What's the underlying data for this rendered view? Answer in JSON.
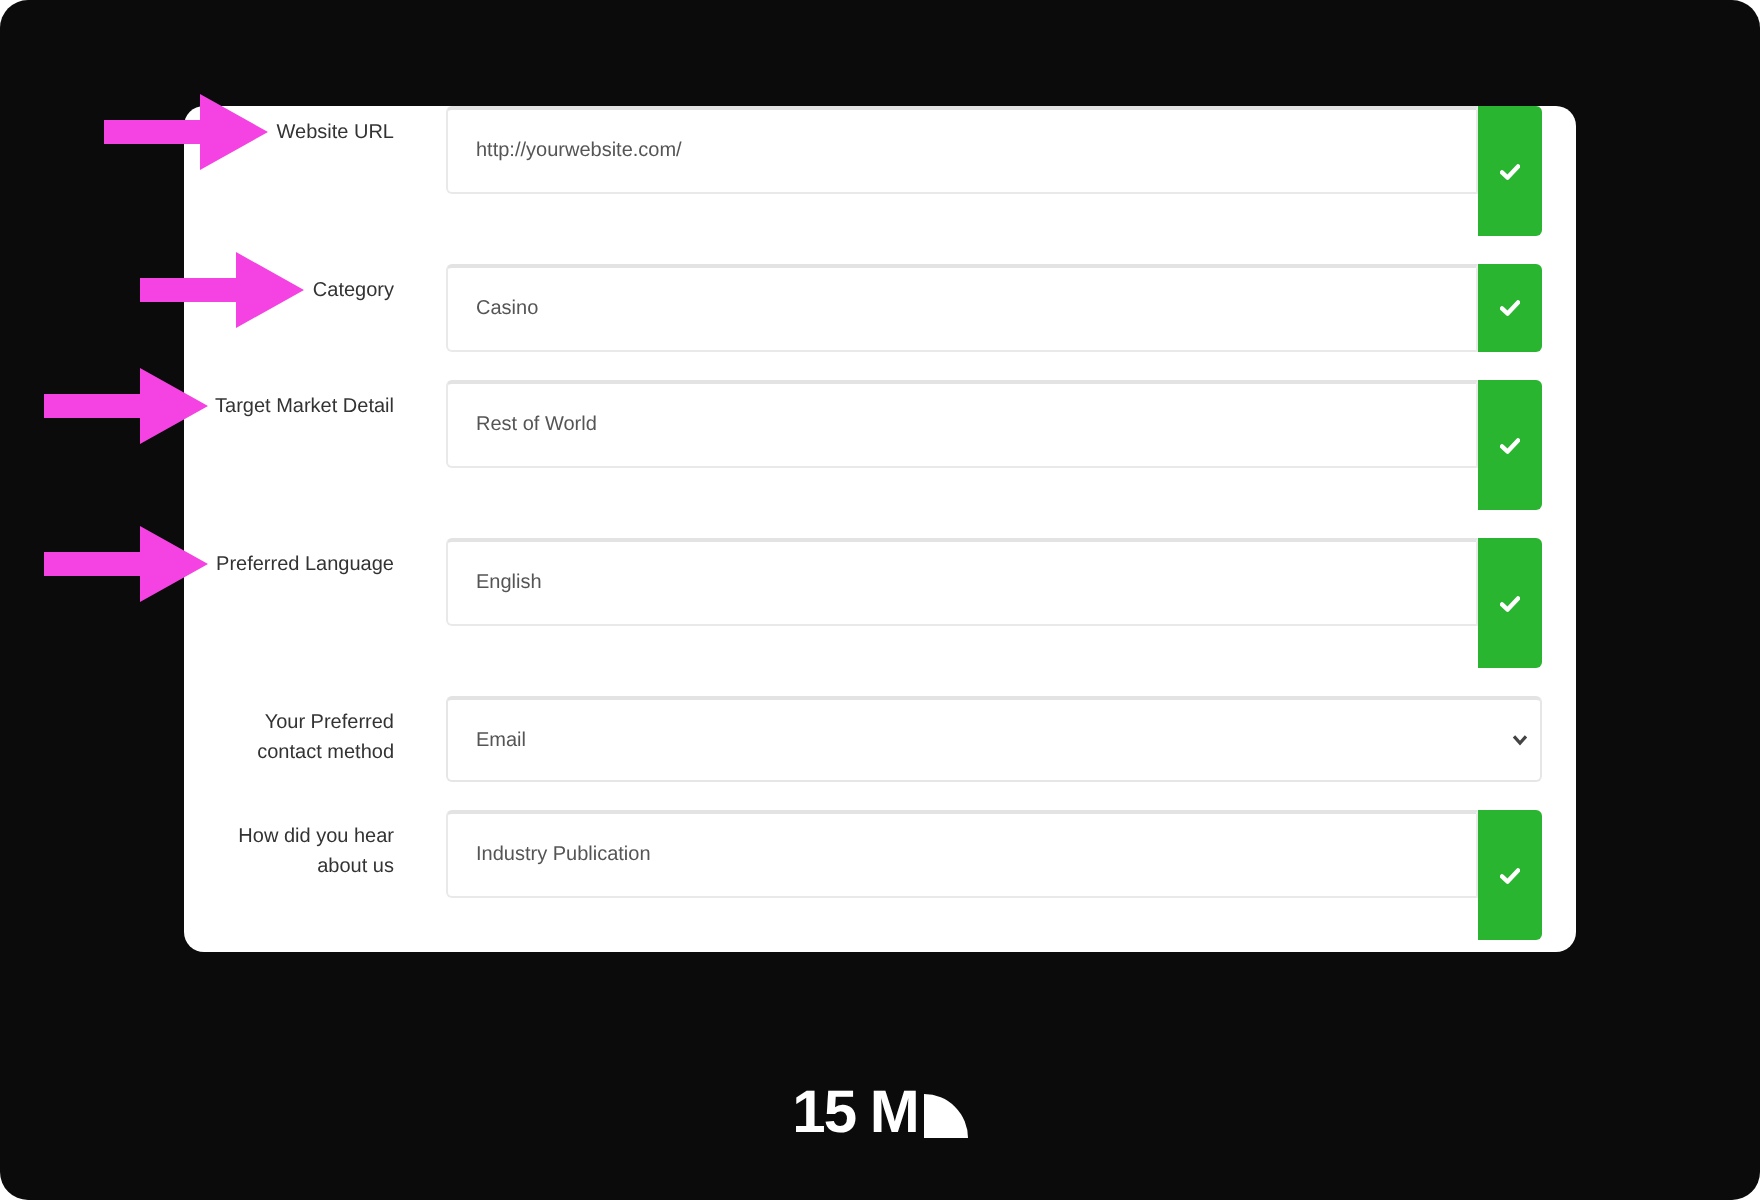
{
  "form": {
    "fields": [
      {
        "kind": "input",
        "label": "Website URL",
        "value": "http://yourwebsite.com/",
        "valid": true,
        "arrow": true
      },
      {
        "kind": "input",
        "label": "Category",
        "value": "Casino",
        "valid": true,
        "arrow": true
      },
      {
        "kind": "input",
        "label": "Target Market Detail",
        "value": "Rest of World",
        "valid": true,
        "arrow": true
      },
      {
        "kind": "input",
        "label": "Preferred Language",
        "value": "English",
        "valid": true,
        "arrow": true
      },
      {
        "kind": "select",
        "label": "Your Preferred contact method",
        "value": "Email",
        "valid": false,
        "arrow": false
      },
      {
        "kind": "input",
        "label": "How did you hear about us",
        "value": "Industry Publication",
        "valid": true,
        "arrow": false
      }
    ]
  },
  "logo": {
    "text": "15 M"
  }
}
